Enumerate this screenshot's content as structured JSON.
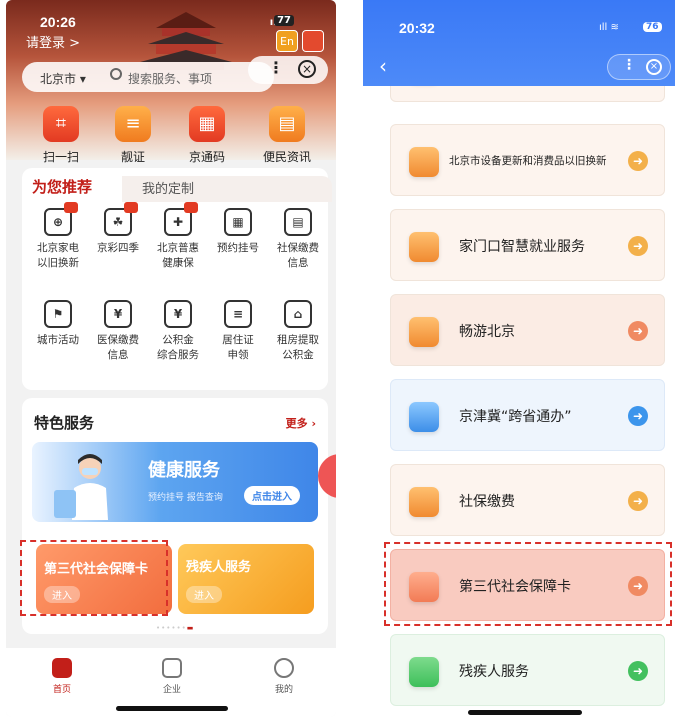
{
  "left": {
    "status": {
      "time": "20:26",
      "battery": "77",
      "signal": "ıll"
    },
    "login": "请登录 >",
    "en_badge": "En",
    "search": {
      "city": "北京市 ▾",
      "placeholder": "搜索服务、事项"
    },
    "quick": [
      {
        "label": "扫一扫",
        "icon": "scan-icon",
        "glyph": "⌗"
      },
      {
        "label": "靓证",
        "icon": "id-card-icon",
        "glyph": "≡"
      },
      {
        "label": "京通码",
        "icon": "qrcode-icon",
        "glyph": "▦"
      },
      {
        "label": "便民资讯",
        "icon": "news-icon",
        "glyph": "▤"
      }
    ],
    "rec_tabs": {
      "active": "为您推荐",
      "other": "我的定制"
    },
    "grid": [
      {
        "line1": "北京家电",
        "line2": "以旧换新",
        "glyph": "⊕",
        "hot": true
      },
      {
        "line1": "京彩四季",
        "line2": "",
        "glyph": "☘",
        "hot": true
      },
      {
        "line1": "北京普惠",
        "line2": "健康保",
        "glyph": "✚",
        "hot": true
      },
      {
        "line1": "预约挂号",
        "line2": "",
        "glyph": "▦",
        "hot": false
      },
      {
        "line1": "社保缴费",
        "line2": "信息",
        "glyph": "▤",
        "hot": false
      },
      {
        "line1": "城市活动",
        "line2": "",
        "glyph": "⚑",
        "hot": false
      },
      {
        "line1": "医保缴费",
        "line2": "信息",
        "glyph": "¥",
        "hot": false
      },
      {
        "line1": "公积金",
        "line2": "综合服务",
        "glyph": "¥",
        "hot": false
      },
      {
        "line1": "居住证",
        "line2": "申领",
        "glyph": "≡",
        "hot": false
      },
      {
        "line1": "租房提取",
        "line2": "公积金",
        "glyph": "⌂",
        "hot": false
      }
    ],
    "featured": {
      "title": "特色服务",
      "more": "更多 ›",
      "health": {
        "title": "健康服务",
        "sub": "预约挂号  报告查询",
        "btn": "点击进入"
      },
      "card3": {
        "title": "第三代社会保障卡",
        "enter": "进入"
      },
      "disabled": {
        "title": "残疾人服务",
        "enter": "进入"
      },
      "pager": "••••••"
    },
    "tabbar": [
      {
        "label": "首页"
      },
      {
        "label": "企业"
      },
      {
        "label": "我的"
      }
    ]
  },
  "right": {
    "status": {
      "time": "20:32",
      "battery": "76",
      "signal": "ıll  ≋"
    },
    "services": [
      {
        "label": "北京市设备更新和消费品以旧换新",
        "icon": "renewal-icon",
        "style": "",
        "small": true
      },
      {
        "label": "家门口智慧就业服务",
        "icon": "briefcase-icon",
        "style": "",
        "small": false
      },
      {
        "label": "畅游北京",
        "icon": "palace-icon",
        "style": "peach",
        "small": false
      },
      {
        "label": "京津冀“跨省通办”",
        "icon": "document-icon",
        "style": "blue",
        "small": false
      },
      {
        "label": "社保缴费",
        "icon": "id-card-icon",
        "style": "",
        "small": false
      },
      {
        "label": "第三代社会保障卡",
        "icon": "card-icon",
        "style": "red",
        "small": false
      },
      {
        "label": "残疾人服务",
        "icon": "wheelchair-icon",
        "style": "green",
        "small": false
      }
    ]
  }
}
